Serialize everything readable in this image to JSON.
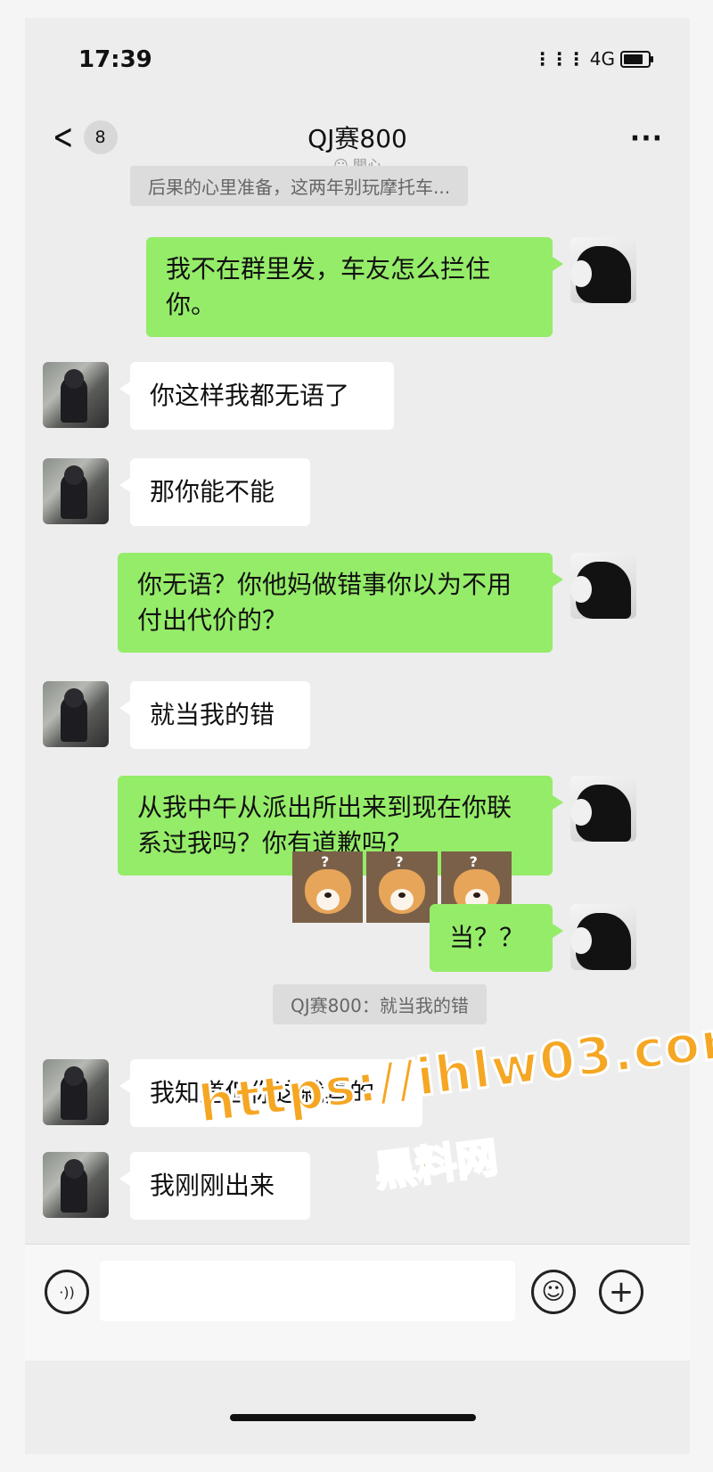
{
  "status_bar": {
    "time": "17:39",
    "network": "4G",
    "battery_level": 0.8
  },
  "nav": {
    "back_badge": "8",
    "title": "QJ赛800",
    "status": "開心"
  },
  "quoted_top": "后果的心里准备，这两年别玩摩托车...",
  "messages": [
    {
      "sender": "self",
      "text": "我不在群里发，车友怎么拦住你。"
    },
    {
      "sender": "other",
      "text": "你这样我都无语了"
    },
    {
      "sender": "other",
      "text": "那你能不能"
    },
    {
      "sender": "self",
      "text": "你无语？你他妈做错事你以为不用付出代价的？"
    },
    {
      "sender": "other",
      "text": "就当我的错"
    },
    {
      "sender": "self",
      "text": "从我中午从派出所出来到现在你联系过我吗？你有道歉吗？"
    },
    {
      "sender": "self",
      "text": "当？？"
    },
    {
      "sender": "other",
      "text": "我知道但你这就真的"
    },
    {
      "sender": "other",
      "text": "我刚刚出来"
    }
  ],
  "quote_reply": "QJ赛800：就当我的错",
  "sticker_marks": [
    "?",
    "?",
    "?"
  ],
  "input": {
    "placeholder": "",
    "value": ""
  },
  "watermark": {
    "line1": "https://ihlw03.com",
    "line2": "黑料网"
  },
  "colors": {
    "self_bubble": "#95ec69",
    "other_bubble": "#ffffff",
    "background": "#ededed",
    "watermark": "#f5a623"
  }
}
